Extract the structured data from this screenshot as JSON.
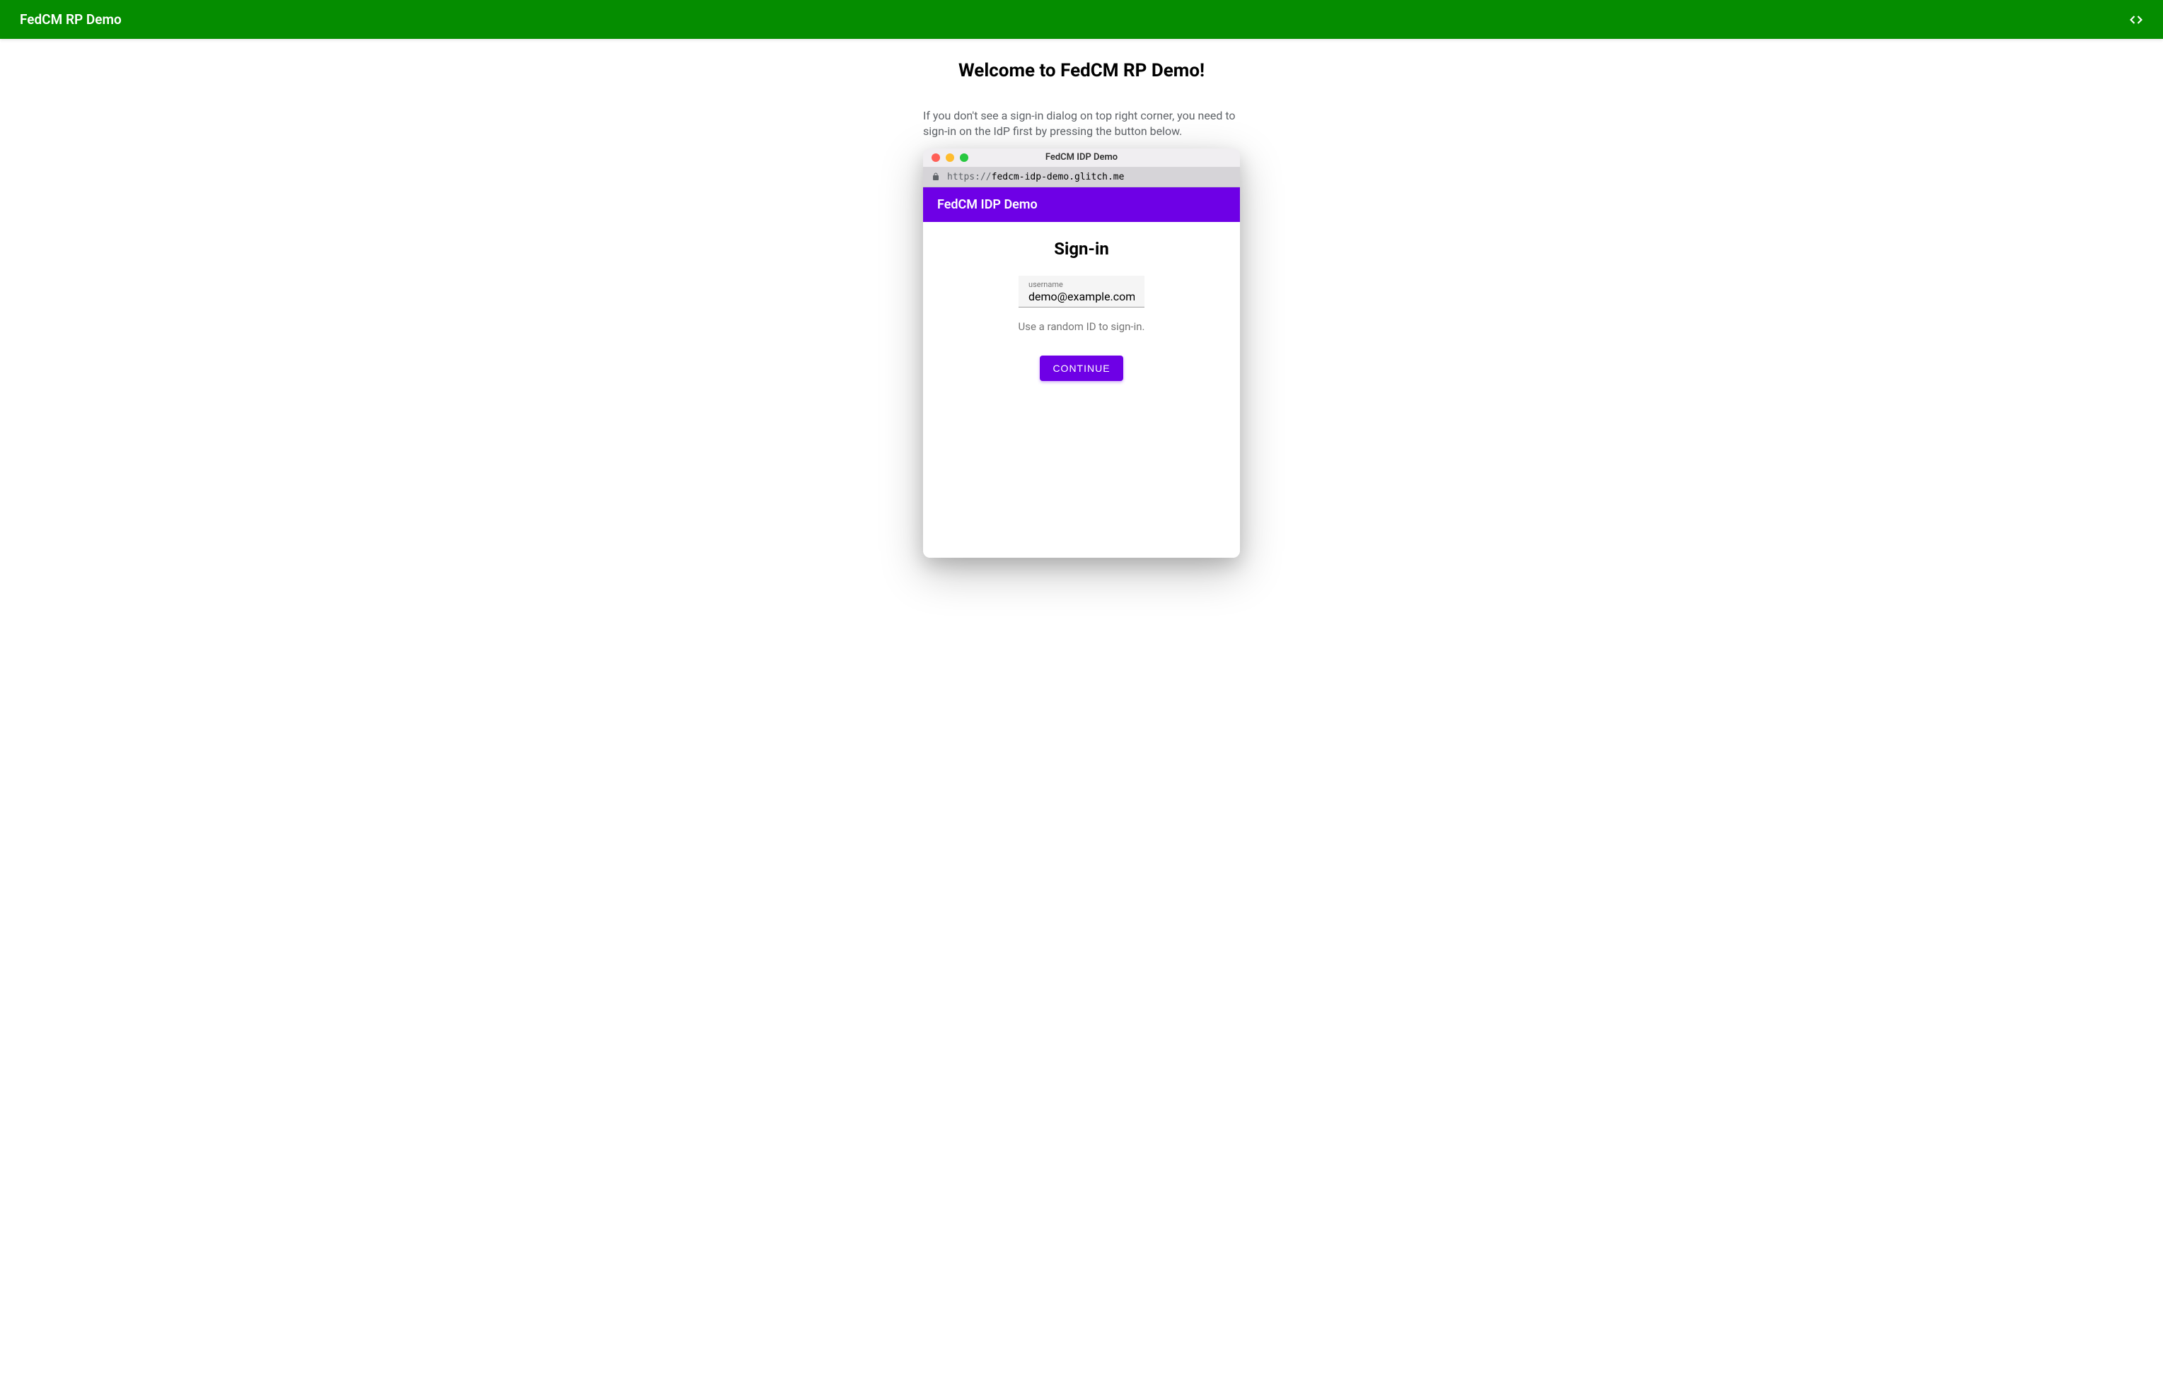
{
  "header": {
    "title": "FedCM RP Demo"
  },
  "main": {
    "welcome_title": "Welcome to FedCM RP Demo!",
    "instruction_text": "If you don't see a sign-in dialog on top right corner, you need to sign-in on the IdP first by pressing the button below."
  },
  "popup": {
    "window_title": "FedCM IDP Demo",
    "url_protocol": "https://",
    "url_host": "fedcm-idp-demo.glitch.me",
    "header_title": "FedCM IDP Demo",
    "signin_title": "Sign-in",
    "username_label": "username",
    "username_value": "demo@example.com",
    "hint_text": "Use a random ID to sign-in.",
    "continue_label": "CONTINUE"
  }
}
